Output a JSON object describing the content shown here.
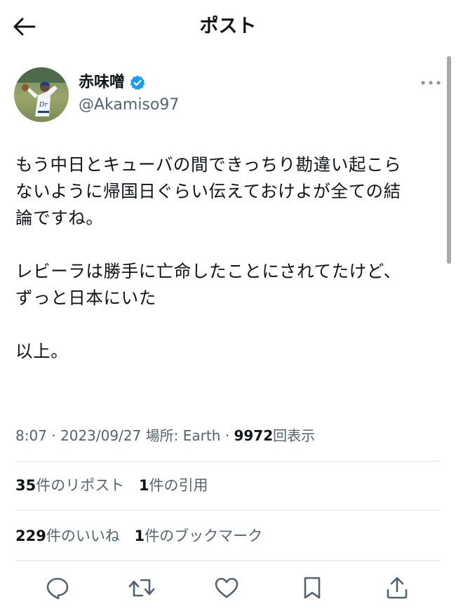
{
  "header": {
    "title": "ポスト",
    "back_icon": "arrow-left-icon"
  },
  "author": {
    "name": "赤味噌",
    "handle": "@Akamiso97",
    "verified_icon": "verified-badge-icon",
    "verified_color": "#1d9bf0",
    "more_icon": "more-horizontal-icon"
  },
  "tweet": {
    "lines": [
      "もう中日とキューバの間できっちり勘違い起こら",
      "ないように帰国日ぐらい伝えておけよが全ての結",
      "論ですね。",
      "",
      "レビーラは勝手に亡命したことにされてたけど、",
      "ずっと日本にいた",
      "",
      "以上。"
    ]
  },
  "meta": {
    "time": "8:07",
    "date": "2023/09/27",
    "location": "場所: Earth",
    "views_count": "9972",
    "views_label": "回表示",
    "separator": " · "
  },
  "stats": {
    "reposts_count": "35",
    "reposts_label": "件のリポスト",
    "quotes_count": "1",
    "quotes_label": "件の引用",
    "likes_count": "229",
    "likes_label": "件のいいね",
    "bookmarks_count": "1",
    "bookmarks_label": "件のブックマーク"
  },
  "actions": [
    {
      "name": "reply",
      "icon": "reply-icon"
    },
    {
      "name": "repost",
      "icon": "repost-icon"
    },
    {
      "name": "like",
      "icon": "heart-icon"
    },
    {
      "name": "bookmark",
      "icon": "bookmark-icon"
    },
    {
      "name": "share",
      "icon": "share-icon"
    }
  ],
  "colors": {
    "text_primary": "#0f1419",
    "text_secondary": "#536471",
    "divider": "#dfe3e6",
    "verified": "#1d9bf0"
  }
}
